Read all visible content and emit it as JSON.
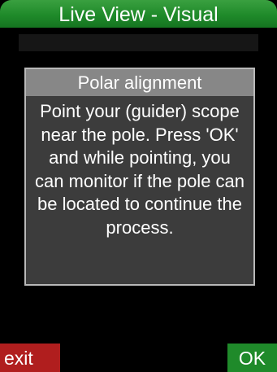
{
  "header": {
    "title": "Live View - Visual"
  },
  "dialog": {
    "title": "Polar alignment",
    "message": "Point your (guider) scope near the pole. Press 'OK' and while pointing, you can monitor if the pole can be located to continue the process."
  },
  "softkeys": {
    "exit_label": "exit",
    "ok_label": "OK"
  },
  "colors": {
    "title_bar": "#1f8a2a",
    "exit_button": "#b01e1e",
    "ok_button": "#1f8a2a",
    "dialog_header": "#878787",
    "dialog_body": "#3c3c3c"
  }
}
